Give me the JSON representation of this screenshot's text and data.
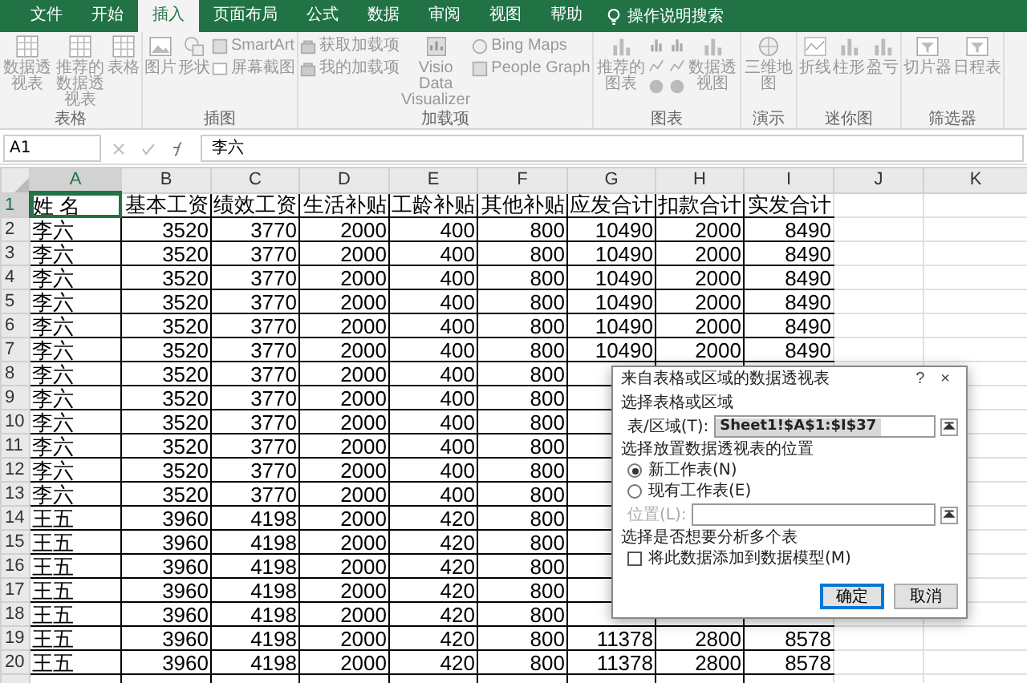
{
  "ribbon_tabs": [
    {
      "label": "文件",
      "selected": false
    },
    {
      "label": "开始",
      "selected": false
    },
    {
      "label": "插入",
      "selected": true
    },
    {
      "label": "页面布局",
      "selected": false
    },
    {
      "label": "公式",
      "selected": false
    },
    {
      "label": "数据",
      "selected": false
    },
    {
      "label": "审阅",
      "selected": false
    },
    {
      "label": "视图",
      "selected": false
    },
    {
      "label": "帮助",
      "selected": false
    }
  ],
  "tell_me": "操作说明搜索",
  "ribbon_groups": [
    {
      "label": "表格",
      "items": [
        {
          "kind": "large",
          "label": "数据透视表"
        },
        {
          "kind": "large",
          "label": "推荐的数据透视表"
        },
        {
          "kind": "large",
          "label": "表格"
        }
      ]
    },
    {
      "label": "插图",
      "items": [
        {
          "kind": "large",
          "label": "图片"
        },
        {
          "kind": "large",
          "label": "形状"
        },
        {
          "kind": "stack",
          "entries": [
            {
              "label": "SmartArt"
            },
            {
              "label": "屏幕截图"
            }
          ]
        }
      ]
    },
    {
      "label": "加载项",
      "items": [
        {
          "kind": "stack",
          "entries": [
            {
              "label": "获取加载项"
            },
            {
              "label": "我的加载项"
            }
          ]
        },
        {
          "kind": "large",
          "label": "Visio Data Visualizer"
        },
        {
          "kind": "stack",
          "entries": [
            {
              "label": "Bing Maps"
            },
            {
              "label": "People Graph"
            }
          ]
        }
      ]
    },
    {
      "label": "图表",
      "items": [
        {
          "kind": "large",
          "label": "推荐的图表"
        },
        {
          "kind": "grid"
        },
        {
          "kind": "large",
          "label": "数据透视图"
        }
      ]
    },
    {
      "label": "演示",
      "items": [
        {
          "kind": "large",
          "label": "三维地图"
        }
      ]
    },
    {
      "label": "迷你图",
      "items": [
        {
          "kind": "large",
          "label": "折线"
        },
        {
          "kind": "large",
          "label": "柱形"
        },
        {
          "kind": "large",
          "label": "盈亏"
        }
      ]
    },
    {
      "label": "筛选器",
      "items": [
        {
          "kind": "large",
          "label": "切片器"
        },
        {
          "kind": "large",
          "label": "日程表"
        }
      ]
    }
  ],
  "name_box": "A1",
  "formula": "李六",
  "columns": [
    {
      "label": "A",
      "selected": true
    },
    {
      "label": "B",
      "selected": false
    },
    {
      "label": "C",
      "selected": false
    },
    {
      "label": "D",
      "selected": false
    },
    {
      "label": "E",
      "selected": false
    },
    {
      "label": "F",
      "selected": false
    },
    {
      "label": "G",
      "selected": false
    },
    {
      "label": "H",
      "selected": false
    },
    {
      "label": "I",
      "selected": false
    },
    {
      "label": "J",
      "selected": false
    },
    {
      "label": "K",
      "selected": false
    }
  ],
  "rows": [
    {
      "header": "1",
      "selected": true,
      "cells": [
        "姓 名",
        "基本工资",
        "绩效工资",
        "生活补贴",
        "工龄补贴",
        "其他补贴",
        "应发合计",
        "扣款合计",
        "实发合计"
      ]
    },
    {
      "header": "2",
      "selected": false,
      "cells": [
        "李六",
        "3520",
        "3770",
        "2000",
        "400",
        "800",
        "10490",
        "2000",
        "8490"
      ]
    },
    {
      "header": "3",
      "selected": false,
      "cells": [
        "李六",
        "3520",
        "3770",
        "2000",
        "400",
        "800",
        "10490",
        "2000",
        "8490"
      ]
    },
    {
      "header": "4",
      "selected": false,
      "cells": [
        "李六",
        "3520",
        "3770",
        "2000",
        "400",
        "800",
        "10490",
        "2000",
        "8490"
      ]
    },
    {
      "header": "5",
      "selected": false,
      "cells": [
        "李六",
        "3520",
        "3770",
        "2000",
        "400",
        "800",
        "10490",
        "2000",
        "8490"
      ]
    },
    {
      "header": "6",
      "selected": false,
      "cells": [
        "李六",
        "3520",
        "3770",
        "2000",
        "400",
        "800",
        "10490",
        "2000",
        "8490"
      ]
    },
    {
      "header": "7",
      "selected": false,
      "cells": [
        "李六",
        "3520",
        "3770",
        "2000",
        "400",
        "800",
        "10490",
        "2000",
        "8490"
      ]
    },
    {
      "header": "8",
      "selected": false,
      "cells": [
        "李六",
        "3520",
        "3770",
        "2000",
        "400",
        "800",
        null,
        null,
        null
      ]
    },
    {
      "header": "9",
      "selected": false,
      "cells": [
        "李六",
        "3520",
        "3770",
        "2000",
        "400",
        "800",
        null,
        null,
        null
      ]
    },
    {
      "header": "10",
      "selected": false,
      "cells": [
        "李六",
        "3520",
        "3770",
        "2000",
        "400",
        "800",
        null,
        null,
        null
      ]
    },
    {
      "header": "11",
      "selected": false,
      "cells": [
        "李六",
        "3520",
        "3770",
        "2000",
        "400",
        "800",
        null,
        null,
        null
      ]
    },
    {
      "header": "12",
      "selected": false,
      "cells": [
        "李六",
        "3520",
        "3770",
        "2000",
        "400",
        "800",
        null,
        null,
        null
      ]
    },
    {
      "header": "13",
      "selected": false,
      "cells": [
        "李六",
        "3520",
        "3770",
        "2000",
        "400",
        "800",
        null,
        null,
        null
      ]
    },
    {
      "header": "14",
      "selected": false,
      "cells": [
        "王五",
        "3960",
        "4198",
        "2000",
        "420",
        "800",
        null,
        null,
        null
      ]
    },
    {
      "header": "15",
      "selected": false,
      "cells": [
        "王五",
        "3960",
        "4198",
        "2000",
        "420",
        "800",
        null,
        null,
        null
      ]
    },
    {
      "header": "16",
      "selected": false,
      "cells": [
        "王五",
        "3960",
        "4198",
        "2000",
        "420",
        "800",
        null,
        null,
        null
      ]
    },
    {
      "header": "17",
      "selected": false,
      "cells": [
        "王五",
        "3960",
        "4198",
        "2000",
        "420",
        "800",
        null,
        null,
        null
      ]
    },
    {
      "header": "18",
      "selected": false,
      "cells": [
        "王五",
        "3960",
        "4198",
        "2000",
        "420",
        "800",
        null,
        null,
        null
      ]
    },
    {
      "header": "19",
      "selected": false,
      "cells": [
        "王五",
        "3960",
        "4198",
        "2000",
        "420",
        "800",
        "11378",
        "2800",
        "8578"
      ]
    },
    {
      "header": "20",
      "selected": false,
      "cells": [
        "王五",
        "3960",
        "4198",
        "2000",
        "420",
        "800",
        "11378",
        "2800",
        "8578"
      ]
    }
  ],
  "dialog": {
    "title": "来自表格或区域的数据透视表",
    "help": "?",
    "close": "×",
    "section_1": "选择表格或区域",
    "range_label": "表/区域(T):",
    "range_value": "Sheet1!$A$1:$I$37",
    "section_2": "选择放置数据透视表的位置",
    "placement": [
      {
        "label": "新工作表(N)",
        "selected": true
      },
      {
        "label": "现有工作表(E)",
        "selected": false
      }
    ],
    "location_label": "位置(L):",
    "section_3": "选择是否想要分析多个表",
    "data_model": {
      "label": "将此数据添加到数据模型(M)",
      "checked": false
    },
    "buttons": [
      {
        "label": "确定",
        "default": true
      },
      {
        "label": "取消",
        "default": false
      }
    ]
  }
}
